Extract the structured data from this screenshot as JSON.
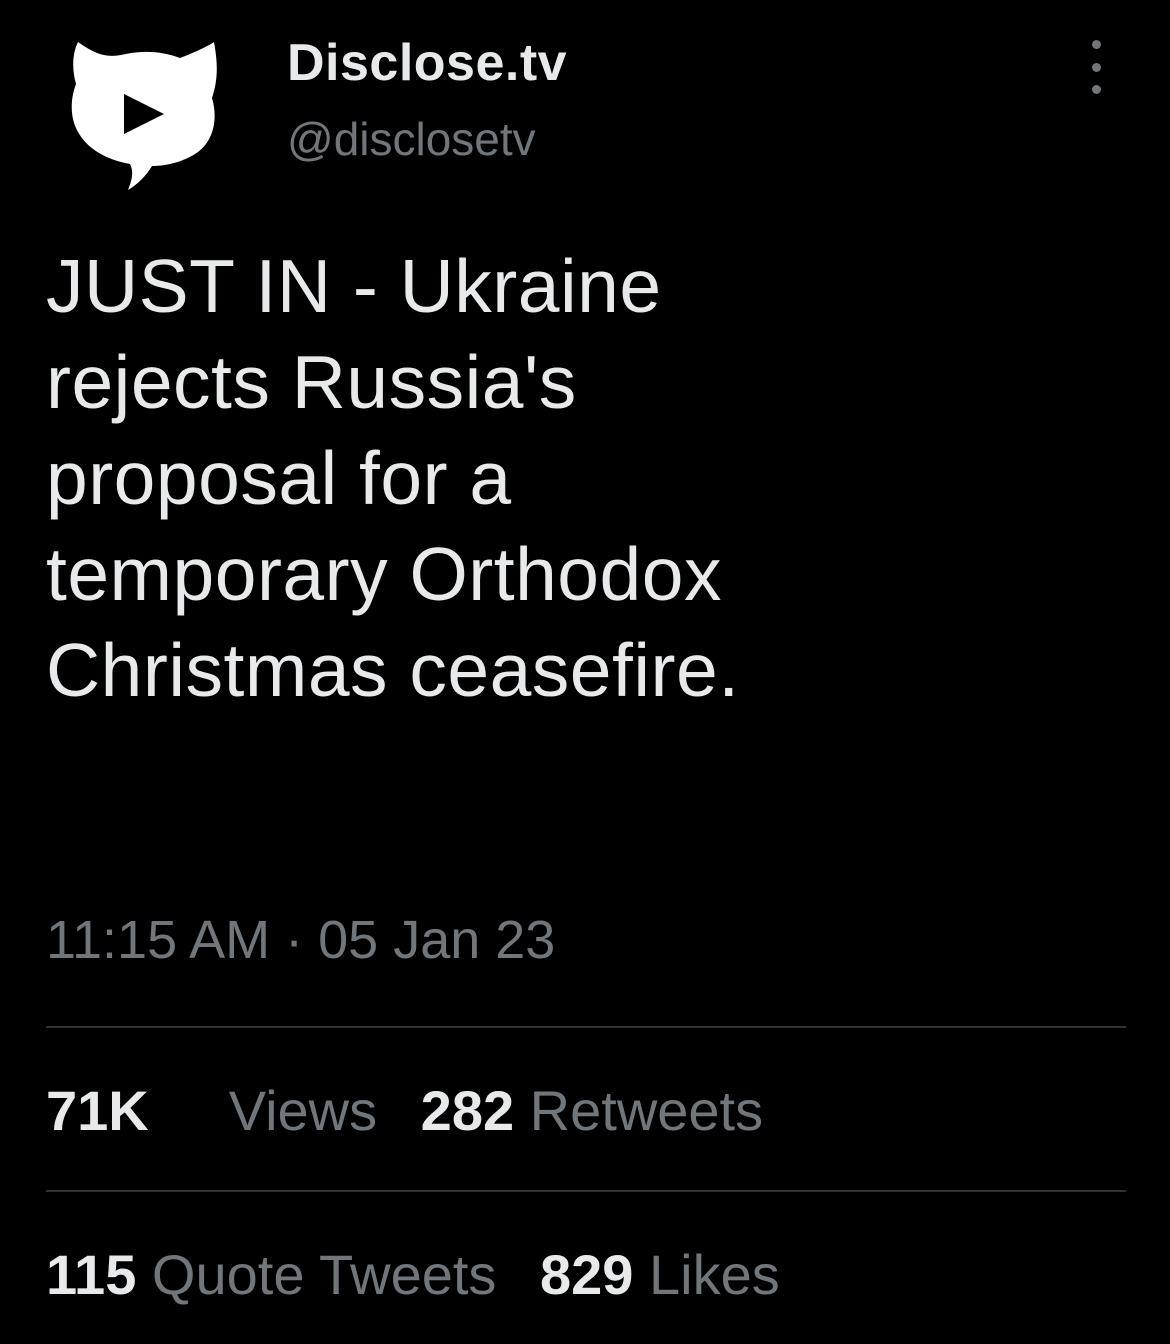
{
  "account": {
    "display_name": "Disclose.tv",
    "handle": "@disclosetv",
    "avatar_icon": "play-speech-bubble-icon"
  },
  "more_icon": "more-vertical-icon",
  "tweet": {
    "text": "JUST IN - Ukraine\nrejects Russia's\nproposal for a\ntemporary Orthodox\nChristmas ceasefire.",
    "timestamp": "11:15 AM · 05 Jan 23"
  },
  "stats": {
    "views": {
      "count": "71K",
      "label": "Views"
    },
    "retweets": {
      "count": "282",
      "label": "Retweets"
    },
    "quote_tweets": {
      "count": "115",
      "label": "Quote Tweets"
    },
    "likes": {
      "count": "829",
      "label": "Likes"
    }
  },
  "colors": {
    "background": "#000000",
    "primary_text": "#e7e9ea",
    "secondary_text": "#71767b",
    "divider": "#2f3336"
  }
}
